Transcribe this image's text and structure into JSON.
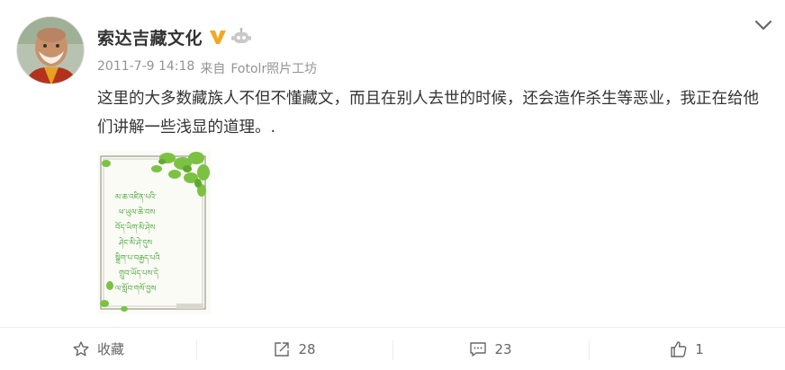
{
  "post": {
    "user_name": "索达吉藏文化",
    "timestamp": "2011-7-9 14:18",
    "source_prefix": "来自",
    "source_name": "Fotolr照片工坊",
    "content": "这里的大多数藏族人不但不懂藏文，而且在别人去世的时候，还会造作杀生等恶业，我正在给他们讲解一些浅显的道理。.",
    "image_text": [
      "མ་ཆ་འཛིན་པའི་",
      "ཕ་ཡུལ་ཆེ་བས",
      "བོད་ཡིག་མི་ཤེས",
      "ཤེང་མི་ཤེ་དུས",
      "སྒྲིག་པ་བརྒྱད་པའི",
      "གྲུབ་ཡོད་པས་དེ",
      "ལ་སློབ་གསོ་བྱས"
    ],
    "icons": {
      "verified": "verified-v-badge-icon",
      "member": "robot-badge-icon",
      "menu": "chevron-down-icon"
    }
  },
  "actions": {
    "favorite_label": "收藏",
    "repost_count": "28",
    "comment_count": "23",
    "like_count": "1"
  },
  "colors": {
    "verified": "#f5a623",
    "text": "#333333",
    "meta": "#939393",
    "leaf": "#7cc242"
  }
}
